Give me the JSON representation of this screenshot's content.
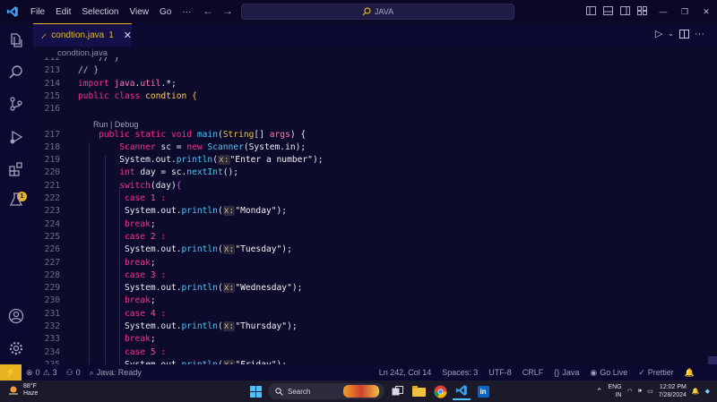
{
  "titlebar": {
    "menu": [
      "File",
      "Edit",
      "Selection",
      "View",
      "Go",
      "···"
    ],
    "search_placeholder": "JAVA"
  },
  "tab": {
    "filename": "condtion.java",
    "problem_count": "1",
    "close_glyph": "✕"
  },
  "breadcrumb": "condtion.java",
  "activity": {
    "extensions_badge": "1"
  },
  "codelens": "Run | Debug",
  "editor_lines": [
    {
      "num": "212",
      "tokens": [
        {
          "t": "    // }",
          "c": "cm"
        }
      ]
    },
    {
      "num": "213",
      "tokens": [
        {
          "t": "// }",
          "c": "cm"
        }
      ]
    },
    {
      "num": "214",
      "tokens": [
        {
          "t": "import ",
          "c": "kw"
        },
        {
          "t": "java",
          "c": "kw2"
        },
        {
          "t": ".",
          "c": "plain"
        },
        {
          "t": "util",
          "c": "kw2"
        },
        {
          "t": ".*;",
          "c": "plain"
        }
      ]
    },
    {
      "num": "215",
      "tokens": [
        {
          "t": "public ",
          "c": "kw"
        },
        {
          "t": "class ",
          "c": "kw"
        },
        {
          "t": "condtion",
          "c": "cls"
        },
        {
          "t": " {",
          "c": "ty"
        }
      ]
    },
    {
      "num": "216",
      "tokens": []
    },
    {
      "num": "217",
      "tokens": [
        {
          "t": "    public ",
          "c": "kw"
        },
        {
          "t": "static ",
          "c": "kw"
        },
        {
          "t": "void ",
          "c": "kw"
        },
        {
          "t": "main",
          "c": "fn"
        },
        {
          "t": "(",
          "c": "plain"
        },
        {
          "t": "String",
          "c": "ty"
        },
        {
          "t": "[] ",
          "c": "plain"
        },
        {
          "t": "args",
          "c": "kw2"
        },
        {
          "t": ") {",
          "c": "plain"
        }
      ]
    },
    {
      "num": "218",
      "tokens": [
        {
          "t": "        Scanner ",
          "c": "kw"
        },
        {
          "t": "sc",
          "c": "plain"
        },
        {
          "t": " = ",
          "c": "plain"
        },
        {
          "t": "new ",
          "c": "kw"
        },
        {
          "t": "Scanner",
          "c": "fn"
        },
        {
          "t": "(System.in);",
          "c": "plain"
        }
      ]
    },
    {
      "num": "219",
      "tokens": [
        {
          "t": "        System.out.",
          "c": "plain"
        },
        {
          "t": "println",
          "c": "fn"
        },
        {
          "t": "(",
          "c": "plain"
        },
        {
          "t": "x:",
          "c": "hint"
        },
        {
          "t": "\"Enter a number\"",
          "c": "str"
        },
        {
          "t": ");",
          "c": "plain"
        }
      ]
    },
    {
      "num": "220",
      "tokens": [
        {
          "t": "        int ",
          "c": "kw"
        },
        {
          "t": "day",
          "c": "plain"
        },
        {
          "t": " = sc.",
          "c": "plain"
        },
        {
          "t": "nextInt",
          "c": "fn"
        },
        {
          "t": "();",
          "c": "plain"
        }
      ]
    },
    {
      "num": "221",
      "tokens": [
        {
          "t": "        switch",
          "c": "kw"
        },
        {
          "t": "(day)",
          "c": "plain"
        },
        {
          "t": "{",
          "c": "brk"
        }
      ]
    },
    {
      "num": "222",
      "tokens": [
        {
          "t": "         case ",
          "c": "kw"
        },
        {
          "t": "1",
          "c": "num"
        },
        {
          "t": " :",
          "c": "kw"
        }
      ]
    },
    {
      "num": "223",
      "tokens": [
        {
          "t": "         System.out.",
          "c": "plain"
        },
        {
          "t": "println",
          "c": "fn"
        },
        {
          "t": "(",
          "c": "plain"
        },
        {
          "t": "x:",
          "c": "hint"
        },
        {
          "t": "\"Monday\"",
          "c": "str"
        },
        {
          "t": ");",
          "c": "plain"
        }
      ]
    },
    {
      "num": "224",
      "tokens": [
        {
          "t": "         break",
          "c": "kw"
        },
        {
          "t": ";",
          "c": "plain"
        }
      ]
    },
    {
      "num": "225",
      "tokens": [
        {
          "t": "         case ",
          "c": "kw"
        },
        {
          "t": "2",
          "c": "num"
        },
        {
          "t": " :",
          "c": "kw"
        }
      ]
    },
    {
      "num": "226",
      "tokens": [
        {
          "t": "         System.out.",
          "c": "plain"
        },
        {
          "t": "println",
          "c": "fn"
        },
        {
          "t": "(",
          "c": "plain"
        },
        {
          "t": "x:",
          "c": "hint"
        },
        {
          "t": "\"Tuesday\"",
          "c": "str"
        },
        {
          "t": ");",
          "c": "plain"
        }
      ]
    },
    {
      "num": "227",
      "tokens": [
        {
          "t": "         break",
          "c": "kw"
        },
        {
          "t": ";",
          "c": "plain"
        }
      ]
    },
    {
      "num": "228",
      "tokens": [
        {
          "t": "         case ",
          "c": "kw"
        },
        {
          "t": "3",
          "c": "num"
        },
        {
          "t": " :",
          "c": "kw"
        }
      ]
    },
    {
      "num": "229",
      "tokens": [
        {
          "t": "         System.out.",
          "c": "plain"
        },
        {
          "t": "println",
          "c": "fn"
        },
        {
          "t": "(",
          "c": "plain"
        },
        {
          "t": "x:",
          "c": "hint"
        },
        {
          "t": "\"Wednesday\"",
          "c": "str"
        },
        {
          "t": ");",
          "c": "plain"
        }
      ]
    },
    {
      "num": "230",
      "tokens": [
        {
          "t": "         break",
          "c": "kw"
        },
        {
          "t": ";",
          "c": "plain"
        }
      ]
    },
    {
      "num": "231",
      "tokens": [
        {
          "t": "         case ",
          "c": "kw"
        },
        {
          "t": "4",
          "c": "num"
        },
        {
          "t": " :",
          "c": "kw"
        }
      ]
    },
    {
      "num": "232",
      "tokens": [
        {
          "t": "         System.out.",
          "c": "plain"
        },
        {
          "t": "println",
          "c": "fn"
        },
        {
          "t": "(",
          "c": "plain"
        },
        {
          "t": "x:",
          "c": "hint"
        },
        {
          "t": "\"Thursday\"",
          "c": "str"
        },
        {
          "t": ");",
          "c": "plain"
        }
      ]
    },
    {
      "num": "233",
      "tokens": [
        {
          "t": "         break",
          "c": "kw"
        },
        {
          "t": ";",
          "c": "plain"
        }
      ]
    },
    {
      "num": "234",
      "tokens": [
        {
          "t": "         case ",
          "c": "kw"
        },
        {
          "t": "5",
          "c": "num"
        },
        {
          "t": " :",
          "c": "kw"
        }
      ]
    },
    {
      "num": "235",
      "tokens": [
        {
          "t": "         System.out.",
          "c": "plain"
        },
        {
          "t": "println",
          "c": "fn"
        },
        {
          "t": "(",
          "c": "plain"
        },
        {
          "t": "x:",
          "c": "hint"
        },
        {
          "t": "\"Friday\"",
          "c": "str"
        },
        {
          "t": ");",
          "c": "plain"
        }
      ]
    }
  ],
  "statusbar": {
    "errors": "0",
    "warnings": "3",
    "ports": "0",
    "java_status": "Java: Ready",
    "position": "Ln 242, Col 14",
    "spaces": "Spaces: 3",
    "encoding": "UTF-8",
    "eol": "CRLF",
    "language": "Java",
    "golive": "Go Live",
    "prettier": "Prettier"
  },
  "taskbar": {
    "temperature": "88°F",
    "weather": "Haze",
    "search_label": "Search",
    "lang_line1": "ENG",
    "lang_line2": "IN",
    "time": "12:02 PM",
    "date": "7/28/2024"
  },
  "colors": {
    "accent": "#e6b422",
    "background": "#0d0b2b",
    "keyword": "#ff2d8a",
    "function": "#4fc3f7"
  }
}
